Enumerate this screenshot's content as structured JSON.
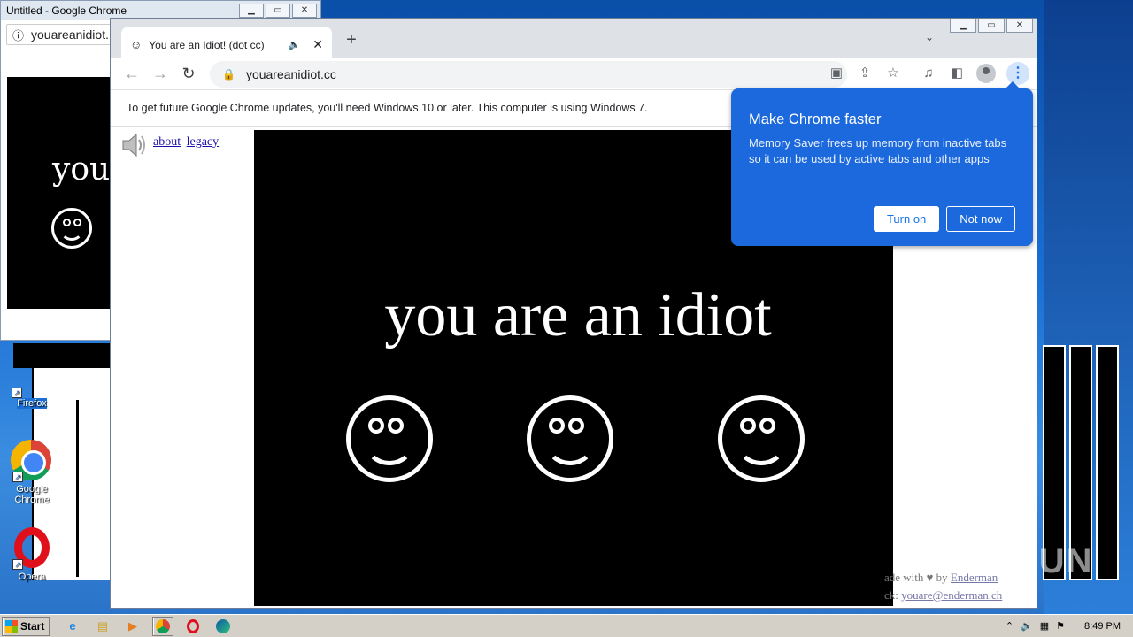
{
  "background_window": {
    "title": "Untitled - Google Chrome",
    "address": "youareanidiot.",
    "content_text": "you"
  },
  "desktop": {
    "icons": [
      {
        "label": "Firefox"
      },
      {
        "label": "Google Chrome"
      },
      {
        "label": "Opera"
      }
    ]
  },
  "browser": {
    "tab_title": "You are an Idiot! (dot cc)",
    "url": "youareanidiot.cc",
    "infobar_text": "To get future Google Chrome updates, you'll need Windows 10 or later. This computer is using Windows 7.",
    "page": {
      "link_about": "about",
      "link_legacy": "legacy",
      "headline": "you are an idiot",
      "credit_line1_prefix": "ade with",
      "credit_line1_by": "by",
      "credit_author": "Enderman",
      "credit_line2_prefix": "ck:",
      "credit_email": "youare@enderman.ch"
    },
    "popup": {
      "title": "Make Chrome faster",
      "body": "Memory Saver frees up memory from inactive tabs so it can be used by active tabs and other apps",
      "turn_on": "Turn on",
      "not_now": "Not now"
    }
  },
  "watermark": "ANY RUN",
  "taskbar": {
    "start_label": "Start",
    "clock": "8:49 PM"
  },
  "colors": {
    "popup_bg": "#1b69dc",
    "accent": "#1a73e8"
  }
}
